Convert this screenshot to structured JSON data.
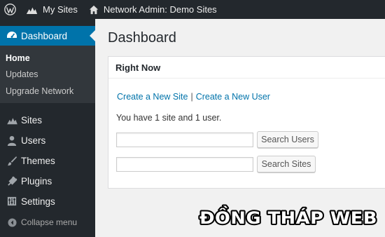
{
  "admin_bar": {
    "my_sites": "My Sites",
    "network_admin": "Network Admin: Demo Sites"
  },
  "sidebar": {
    "current": {
      "label": "Dashboard",
      "icon": "dashboard-icon"
    },
    "submenu": [
      "Home",
      "Updates",
      "Upgrade Network"
    ],
    "items": [
      {
        "label": "Sites",
        "icon": "sites-icon"
      },
      {
        "label": "Users",
        "icon": "users-icon"
      },
      {
        "label": "Themes",
        "icon": "themes-icon"
      },
      {
        "label": "Plugins",
        "icon": "plugins-icon"
      },
      {
        "label": "Settings",
        "icon": "settings-icon"
      },
      {
        "label": "Collapse menu",
        "icon": "collapse-icon"
      }
    ]
  },
  "main": {
    "title": "Dashboard",
    "panel": {
      "title": "Right Now",
      "create_site_link": "Create a New Site",
      "separator": "|",
      "create_user_link": "Create a New User",
      "summary": "You have 1 site and 1 user.",
      "search_users_value": "",
      "search_users_button": "Search Users",
      "search_sites_value": "",
      "search_sites_button": "Search Sites"
    }
  },
  "watermark": {
    "text": "ĐỒNG THÁP WEB"
  }
}
